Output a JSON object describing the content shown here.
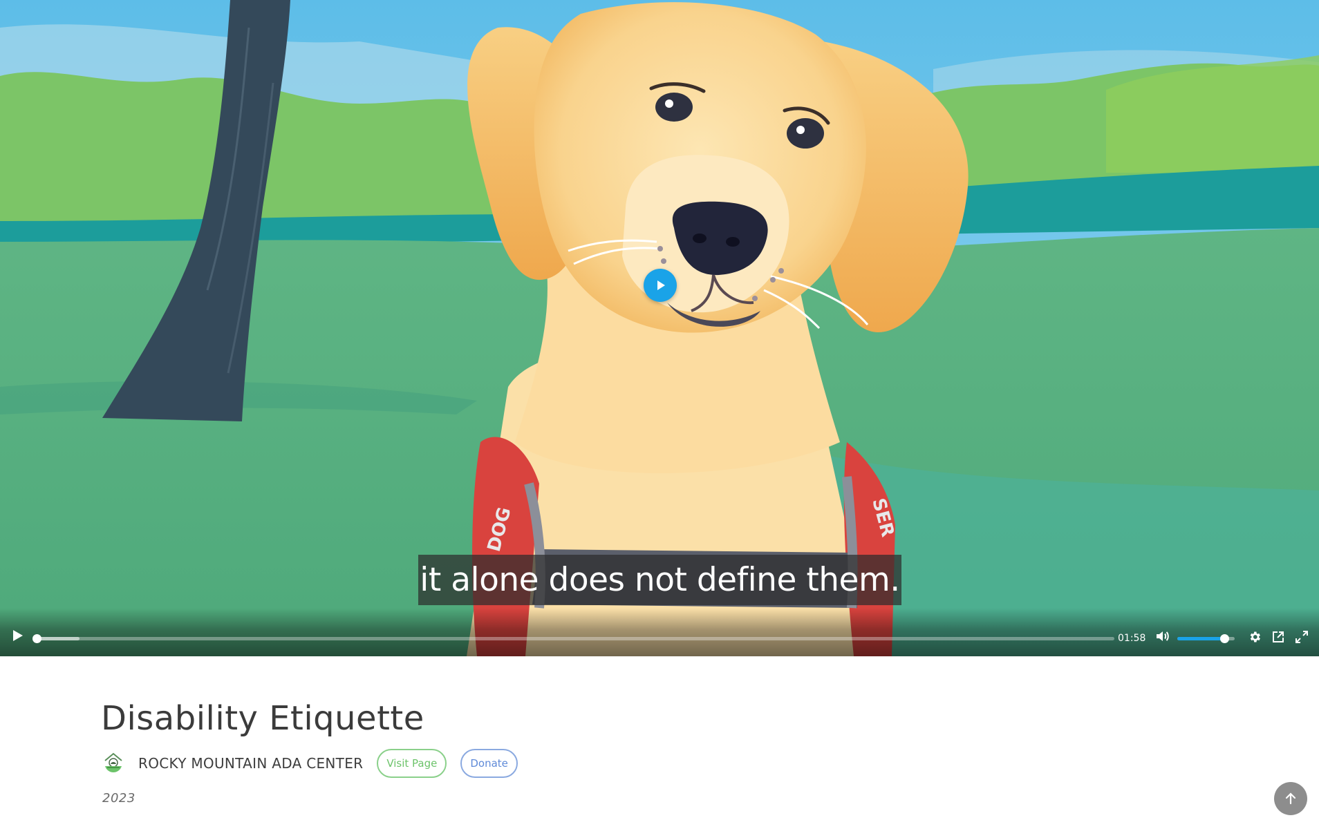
{
  "video": {
    "caption": "it alone does not define them.",
    "duration": "01:58",
    "progress_fraction": 0.0,
    "buffered_fraction": 0.04,
    "volume_fraction": 0.82,
    "vest_text_left": "DOG",
    "vest_text_right": "SER",
    "icons": {
      "big_play": "play-icon",
      "play": "play-icon",
      "mute": "volume-icon",
      "settings": "gear-icon",
      "popout": "external-link-icon",
      "fullscreen": "fullscreen-icon"
    },
    "accent_color": "#1aa3e8"
  },
  "info": {
    "title": "Disability Etiquette",
    "organization": "ROCKY MOUNTAIN ADA CENTER",
    "visit_label": "Visit Page",
    "donate_label": "Donate",
    "year": "2023",
    "visit_color": "#6cc36a",
    "donate_color": "#5f8ad8"
  },
  "scroll_top": {
    "icon": "arrow-up-icon"
  }
}
